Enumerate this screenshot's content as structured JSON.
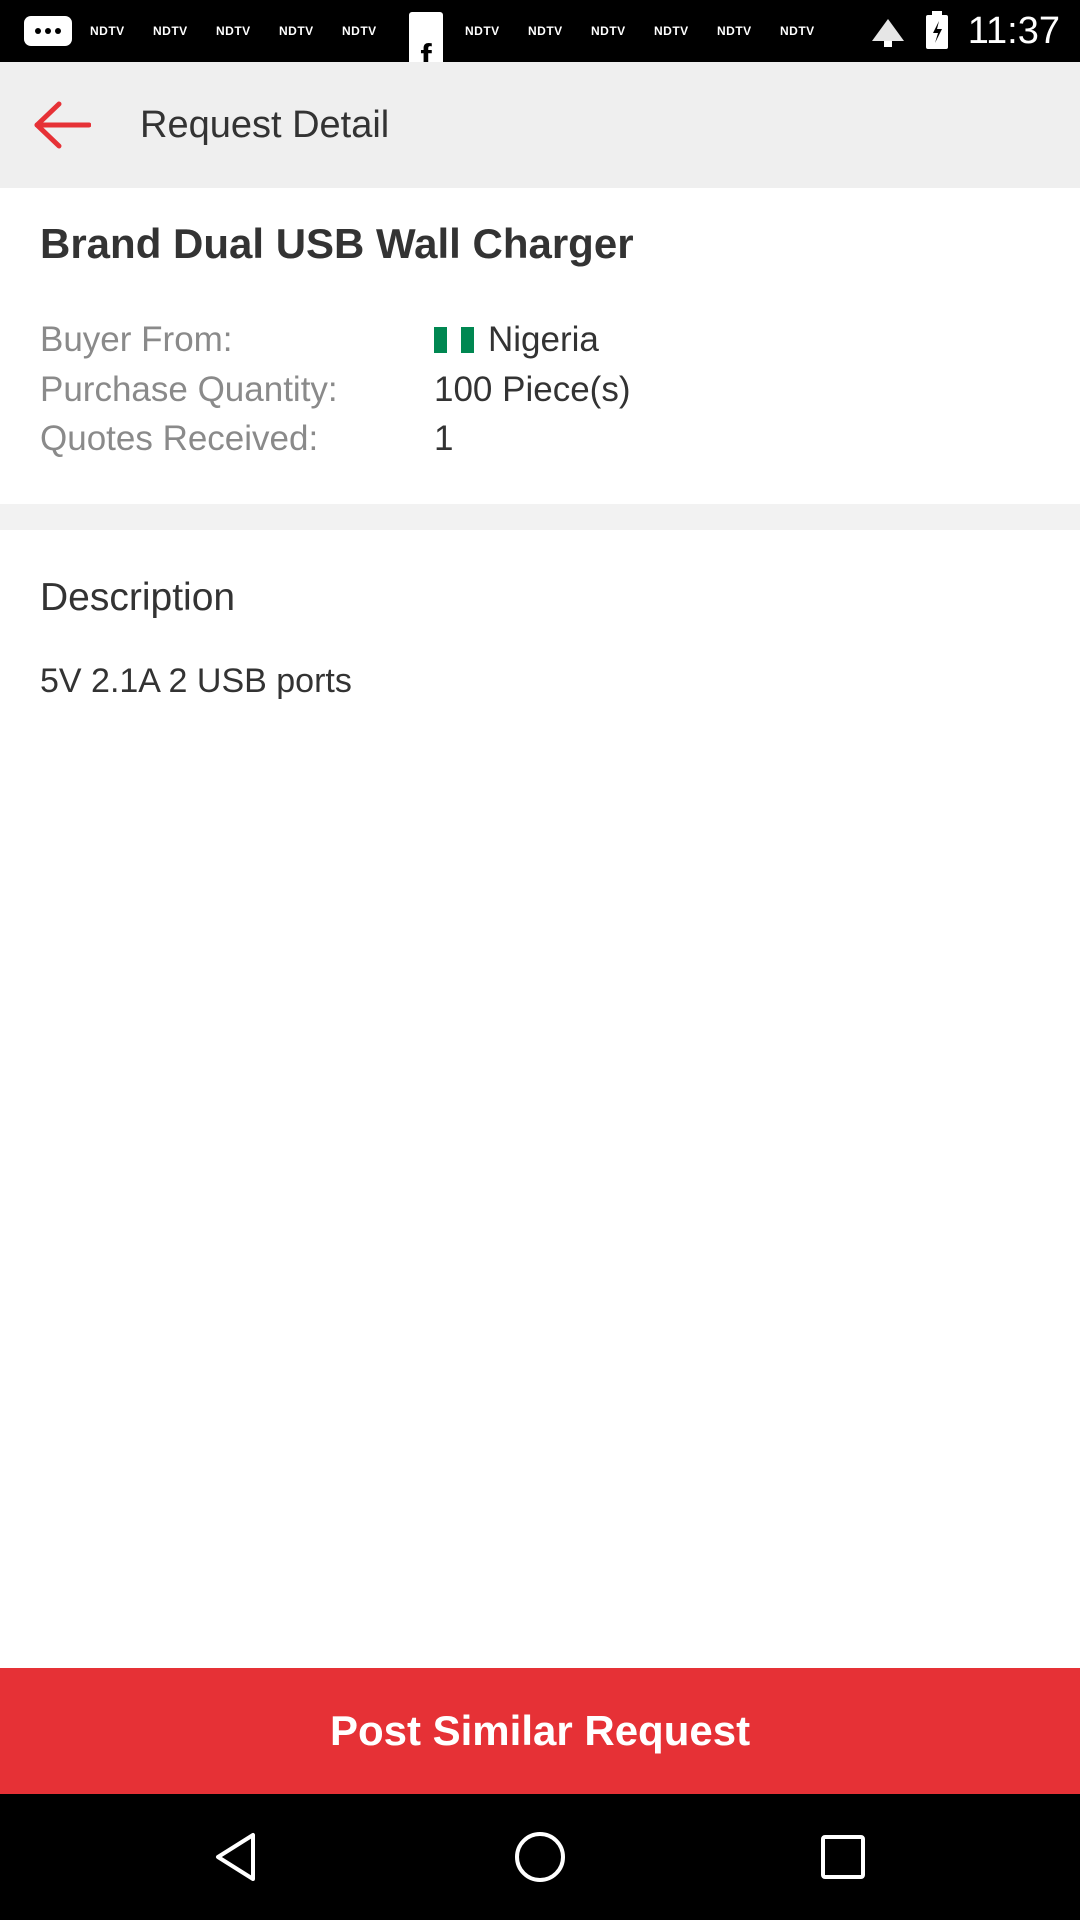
{
  "status_bar": {
    "time": "11:37",
    "notifications": [
      "NDTV",
      "NDTV",
      "NDTV",
      "NDTV",
      "NDTV",
      "NDTV",
      "NDTV",
      "NDTV",
      "NDTV",
      "NDTV",
      "NDTV"
    ],
    "icons": [
      "chat-bubble-icon",
      "facebook-icon",
      "wifi-icon",
      "signal-icon",
      "battery-icon"
    ]
  },
  "app_bar": {
    "title": "Request Detail",
    "back_icon": "arrow-back-icon",
    "accent_color": "#e63136"
  },
  "request": {
    "product_name": "Brand Dual USB Wall Charger",
    "fields": [
      {
        "label": "Buyer From:",
        "value": "Nigeria",
        "flag": "nigeria-flag-icon"
      },
      {
        "label": "Purchase Quantity:",
        "value": "100 Piece(s)"
      },
      {
        "label": "Quotes Received:",
        "value": "1"
      }
    ]
  },
  "description": {
    "heading": "Description",
    "text": "5V 2.1A 2 USB ports"
  },
  "footer": {
    "button_label": "Post Similar Request",
    "button_color": "#e63136"
  },
  "nav_bar": {
    "icons": [
      "back-triangle-icon",
      "home-circle-icon",
      "recents-square-icon"
    ]
  }
}
